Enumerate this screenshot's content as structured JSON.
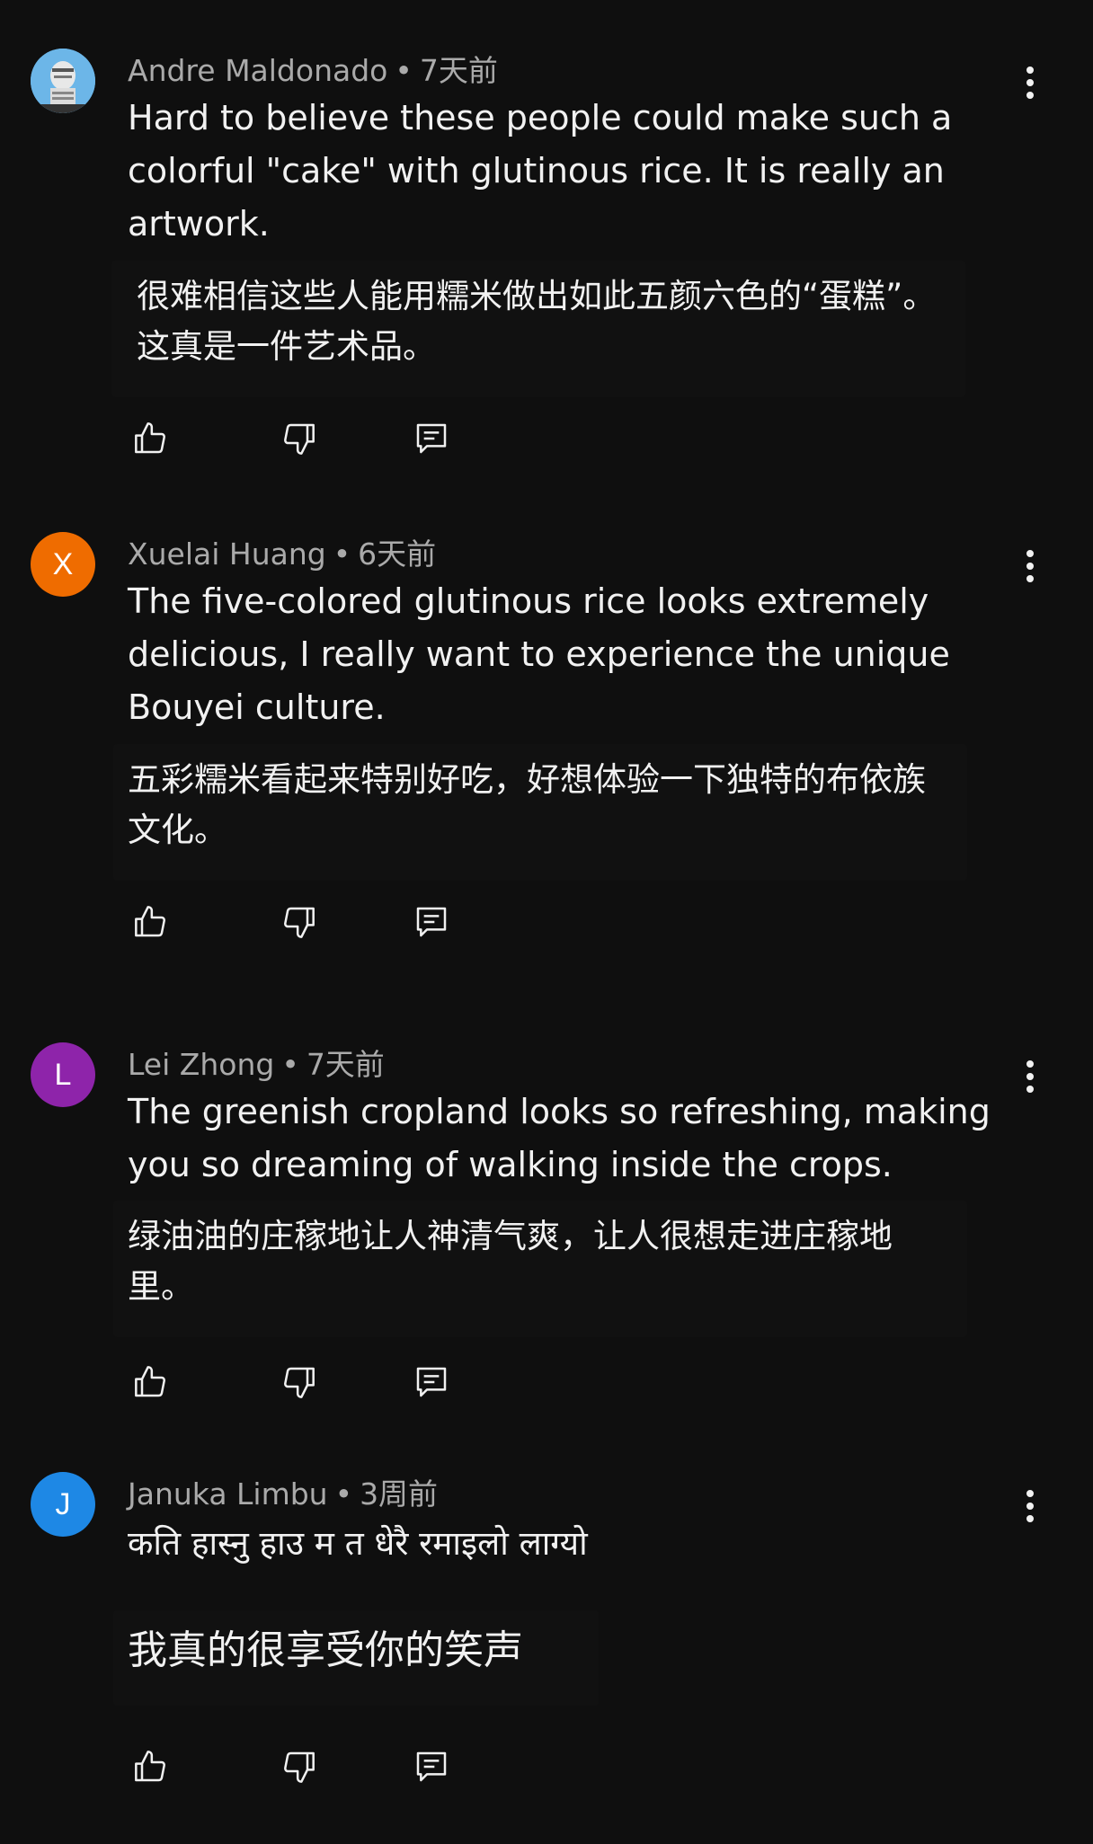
{
  "comments": [
    {
      "author": "Andre Maldonado",
      "time": "7天前",
      "avatar_letter": "",
      "avatar_color": "#5aa9e0",
      "text_original": "Hard to believe these people could make such a colorful \"cake\" with glutinous rice. It is really an artwork.",
      "text_translation": "很难相信这些人能用糯米做出如此五颜六色的“蛋糕”。这真是一件艺术品。"
    },
    {
      "author": "Xuelai Huang",
      "time": "6天前",
      "avatar_letter": "X",
      "avatar_color": "#ef6c00",
      "text_original": "The five-colored glutinous rice looks extremely delicious, I really want to experience the unique Bouyei culture.",
      "text_translation": "五彩糯米看起来特别好吃，好想体验一下独特的布依族文化。"
    },
    {
      "author": "Lei Zhong",
      "time": "7天前",
      "avatar_letter": "L",
      "avatar_color": "#8e24aa",
      "text_original": "The greenish cropland looks so refreshing, making you so dreaming of walking inside the crops.",
      "text_translation": "绿油油的庄稼地让人神清气爽，让人很想走进庄稼地里。"
    },
    {
      "author": "Januka Limbu",
      "time": "3周前",
      "avatar_letter": "J",
      "avatar_color": "#1e88e5",
      "text_original": "कति हास्नु हाउ म त धेरै रमाइलो लाग्यो",
      "text_translation": "我真的很享受你的笑声"
    }
  ],
  "separator": "•",
  "icons": {
    "like": "thumbs-up-icon",
    "dislike": "thumbs-down-icon",
    "reply": "reply-icon",
    "more": "more-vert-icon"
  }
}
